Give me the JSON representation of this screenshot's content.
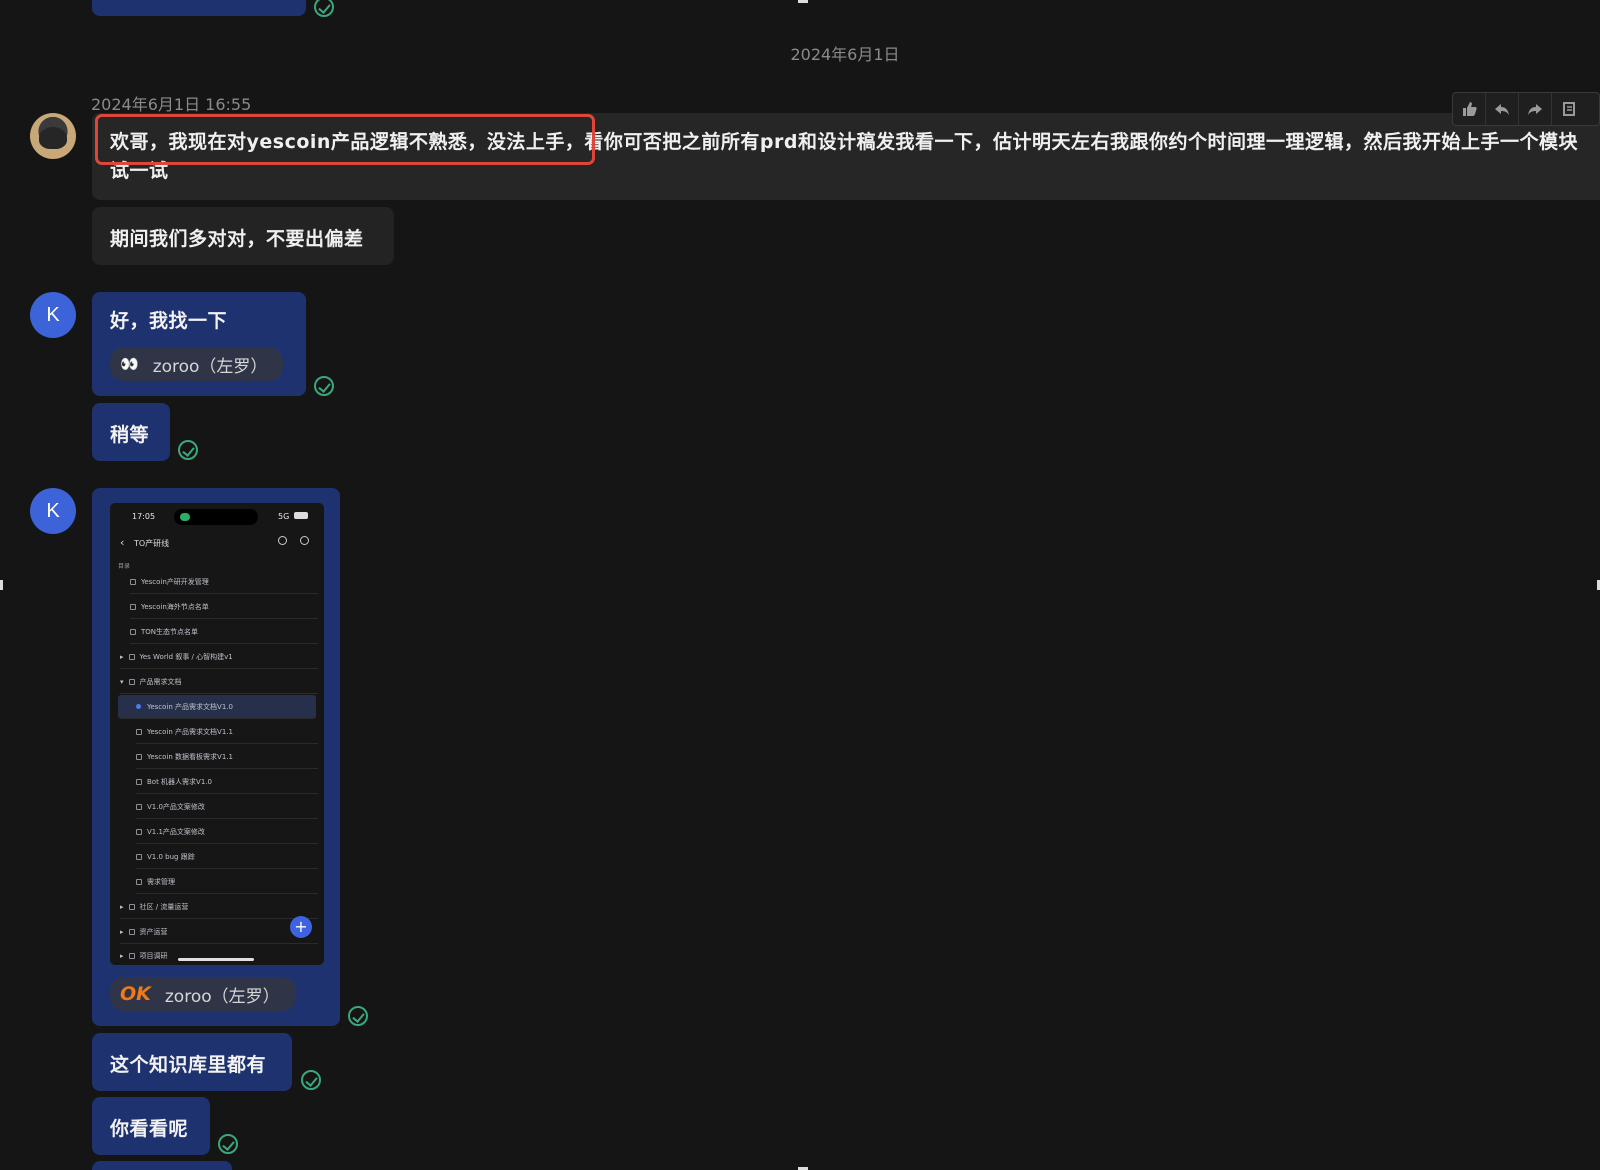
{
  "date_divider": "2024年6月1日",
  "messages": {
    "m1": {
      "timestamp": "2024年6月1日 16:55",
      "text": "欢哥，我现在对yescoin产品逻辑不熟悉，没法上手，看你可否把之前所有prd和设计稿发我看一下，估计明天左右我跟你约个时间理一理逻辑，然后我开始上手一个模块试一试"
    },
    "m2": {
      "text": "期间我们多对对，不要出偏差"
    },
    "m3": {
      "sender_initial": "K",
      "text": "好，我找一下",
      "reaction": {
        "emoji": "👀",
        "name": "zoroo（左罗）"
      }
    },
    "m4": {
      "text": "稍等"
    },
    "m5": {
      "sender_initial": "K",
      "reaction": {
        "emoji": "OK",
        "name": "zoroo（左罗）"
      },
      "screenshot": {
        "time": "17:05",
        "network": "5G",
        "nav_title": "TO产研线",
        "section": "目录",
        "rows": [
          "Yescoin产研开发管理",
          "Yescoin海外节点名单",
          "TON生态节点名单",
          "Yes World 叙事 / 心智构建v1",
          "产品需求文档",
          "Yescoin 产品需求文档V1.0",
          "Yescoin 产品需求文档V1.1",
          "Yescoin 数据看板需求V1.1",
          "Bot 机器人需求V1.0",
          "V1.0产品文案修改",
          "V1.1产品文案修改",
          "V1.0 bug 跟踪",
          "需求管理",
          "社区 / 流量运营",
          "资产运营",
          "项目调研"
        ]
      }
    },
    "m6": {
      "text": "这个知识库里都有"
    },
    "m7": {
      "text": "你看看呢"
    }
  },
  "toolbar": {
    "icons": [
      "thumbs-up-icon",
      "reply-icon",
      "forward-icon",
      "more-icon"
    ]
  },
  "colors": {
    "bubble_blue": "#1f3270",
    "bubble_gray": "#232323",
    "check": "#3aa87a",
    "highlight": "#e0453a",
    "avatar": "#3d63d8"
  }
}
